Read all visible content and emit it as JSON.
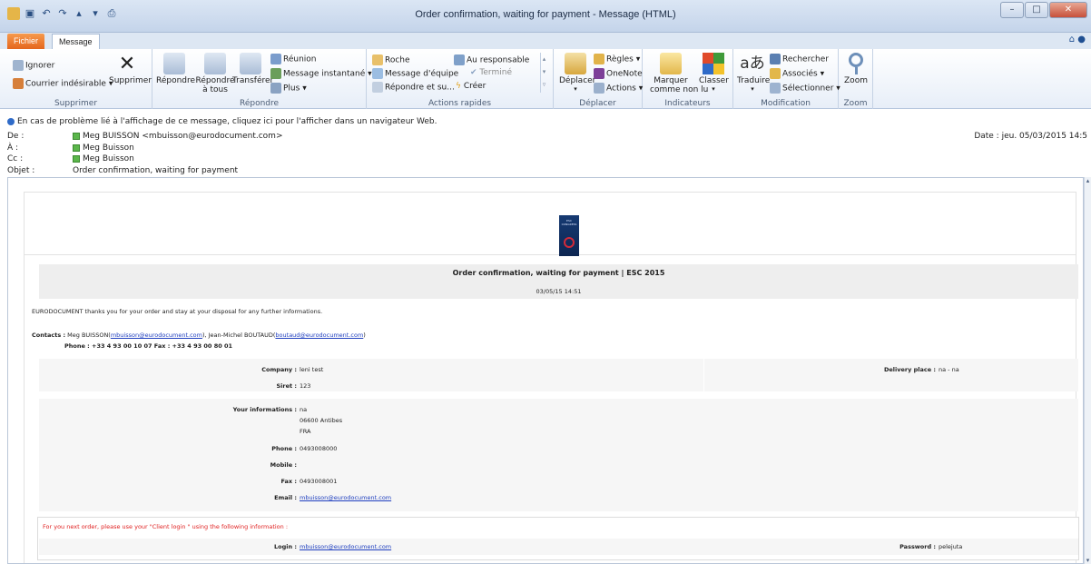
{
  "window": {
    "title": "Order confirmation, waiting for payment - Message (HTML)"
  },
  "tabs": {
    "file": "Fichier",
    "message": "Message"
  },
  "ribbon": {
    "supprimer": {
      "ignorer": "Ignorer",
      "courrier": "Courrier indésirable",
      "supprimer": "Supprimer",
      "label": "Supprimer"
    },
    "repondre": {
      "repondre": "Répondre",
      "repondre_tous_1": "Répondre",
      "repondre_tous_2": "à tous",
      "transferer": "Transférer",
      "reunion": "Réunion",
      "instantane": "Message instantané",
      "plus": "Plus",
      "label": "Répondre"
    },
    "actions": {
      "roche": "Roche",
      "responsable": "Au responsable",
      "equipe": "Message d'équipe",
      "termine": "Terminé",
      "repondre_su": "Répondre et su...",
      "creer": "Créer",
      "label": "Actions rapides"
    },
    "deplacer": {
      "deplacer": "Déplacer",
      "regles": "Règles",
      "onenote": "OneNote",
      "actions": "Actions",
      "label": "Déplacer"
    },
    "indicateurs": {
      "marquer_1": "Marquer",
      "marquer_2": "comme non lu",
      "classer": "Classer",
      "label": "Indicateurs"
    },
    "modification": {
      "traduire": "Traduire",
      "rechercher": "Rechercher",
      "associes": "Associés",
      "selectionner": "Sélectionner",
      "label": "Modification"
    },
    "zoom": {
      "zoom": "Zoom",
      "label": "Zoom"
    }
  },
  "header": {
    "info_bar": "En cas de problème lié à l'affichage de ce message, cliquez ici pour l'afficher dans un navigateur Web.",
    "de_label": "De :",
    "de_value": "Meg BUISSON <mbuisson@eurodocument.com>",
    "a_label": "À :",
    "a_value": "Meg Buisson",
    "cc_label": "Cc :",
    "cc_value": "Meg Buisson",
    "objet_label": "Objet :",
    "objet_value": "Order confirmation, waiting for payment",
    "date": "Date : jeu. 05/03/2015 14:5"
  },
  "email": {
    "logo_text": "ESC CONGRESS",
    "heading": "Order confirmation, waiting for payment | ESC 2015",
    "datetime": "03/05/15 14:51",
    "thanks": "EURODOCUMENT thanks you for your order and stay at your disposal for any further informations.",
    "contacts_label": "Contacts :",
    "contact1": "Meg BUISSON(",
    "contact1_email": "mbuisson@eurodocument.com",
    "contact_sep": "), Jean-Michel BOUTAUD(",
    "contact2_email": "boutaud@eurodocument.com",
    "contact_end": ")",
    "phone_fax": "Phone : +33 4 93 00 10 07   Fax : +33 4 93 00 80 01",
    "company_label": "Company :",
    "company_value": "leni test",
    "delivery_label": "Delivery place :",
    "delivery_value": "na - na",
    "siret_label": "Siret :",
    "siret_value": "123",
    "info_label": "Your informations :",
    "info_line1": "na",
    "info_line2": "06600 Antibes",
    "info_line3": "FRA",
    "phone_label": "Phone :",
    "phone_value": "0493008000",
    "mobile_label": "Mobile :",
    "fax_label": "Fax :",
    "fax_value": "0493008001",
    "email_label": "Email :",
    "email_value": "mbuisson@eurodocument.com",
    "next_order": "For you next order, please use your \"Client login \" using the following information :",
    "login_label": "Login :",
    "login_value": "mbuisson@eurodocument.com",
    "password_label": "Password :",
    "password_value": "pelejuta"
  },
  "icons": [
    "save-icon",
    "undo-icon",
    "redo-icon",
    "print-icon",
    "help-icon",
    "ignore-icon",
    "junk-icon",
    "delete-icon",
    "reply-icon",
    "reply-all-icon",
    "forward-icon",
    "meeting-icon",
    "im-icon",
    "more-icon",
    "move-icon",
    "rules-icon",
    "onenote-icon",
    "actions-icon",
    "unread-icon",
    "categorize-icon",
    "translate-icon",
    "find-icon",
    "related-icon",
    "select-icon",
    "zoom-icon",
    "info-icon",
    "presence-icon"
  ]
}
